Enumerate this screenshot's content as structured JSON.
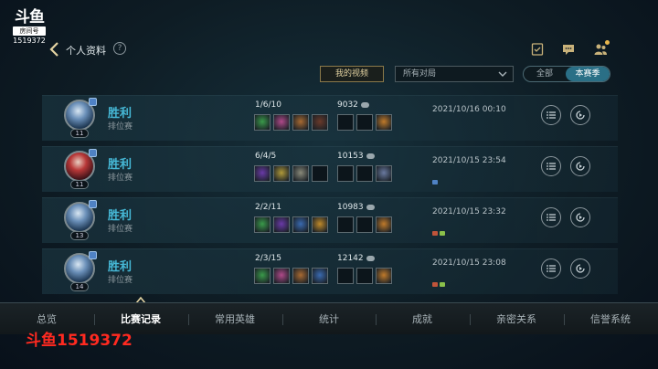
{
  "watermark": {
    "logo": "斗鱼",
    "room_label": "房间号",
    "room_id": "1519372",
    "overlay_text": "斗鱼1519372"
  },
  "header": {
    "title": "个人资料",
    "help": "?"
  },
  "filters": {
    "video_button": "我的视频",
    "match_filter": "所有对局",
    "segment_all": "全部",
    "segment_season": "本赛季"
  },
  "matches": [
    {
      "result": "胜利",
      "mode": "排位赛",
      "level": "11",
      "kda": "1/6/10",
      "gold": "9032",
      "date": "2021/10/16 00:10",
      "avatar": "blue",
      "items": [
        "#3a9a4a",
        "#b04a8a",
        "#a86a32",
        "#6a3a2a",
        "",
        "",
        "#c07a2a"
      ]
    },
    {
      "result": "胜利",
      "mode": "排位赛",
      "level": "11",
      "kda": "6/4/5",
      "gold": "10153",
      "date": "2021/10/15 23:54",
      "avatar": "red",
      "items": [
        "#6a3aa8",
        "#b09a3a",
        "#8a8a7a",
        "",
        "",
        "",
        "#6a7aa0"
      ]
    },
    {
      "result": "胜利",
      "mode": "排位赛",
      "level": "13",
      "kda": "2/2/11",
      "gold": "10983",
      "date": "2021/10/15 23:32",
      "avatar": "blue",
      "items": [
        "#3a9a4a",
        "#6a3aa8",
        "#3a6ab0",
        "#c08a2a",
        "",
        "",
        "#c07a2a"
      ]
    },
    {
      "result": "胜利",
      "mode": "排位赛",
      "level": "14",
      "kda": "2/3/15",
      "gold": "12142",
      "date": "2021/10/15 23:08",
      "avatar": "blue",
      "items": [
        "#3a9a4a",
        "#b04a8a",
        "#a86a32",
        "#3a6ab0",
        "",
        "",
        "#c07a2a"
      ]
    }
  ],
  "nav": [
    "总览",
    "比赛记录",
    "常用英雄",
    "统计",
    "成就",
    "亲密关系",
    "信誉系统"
  ],
  "nav_active": "比赛记录"
}
